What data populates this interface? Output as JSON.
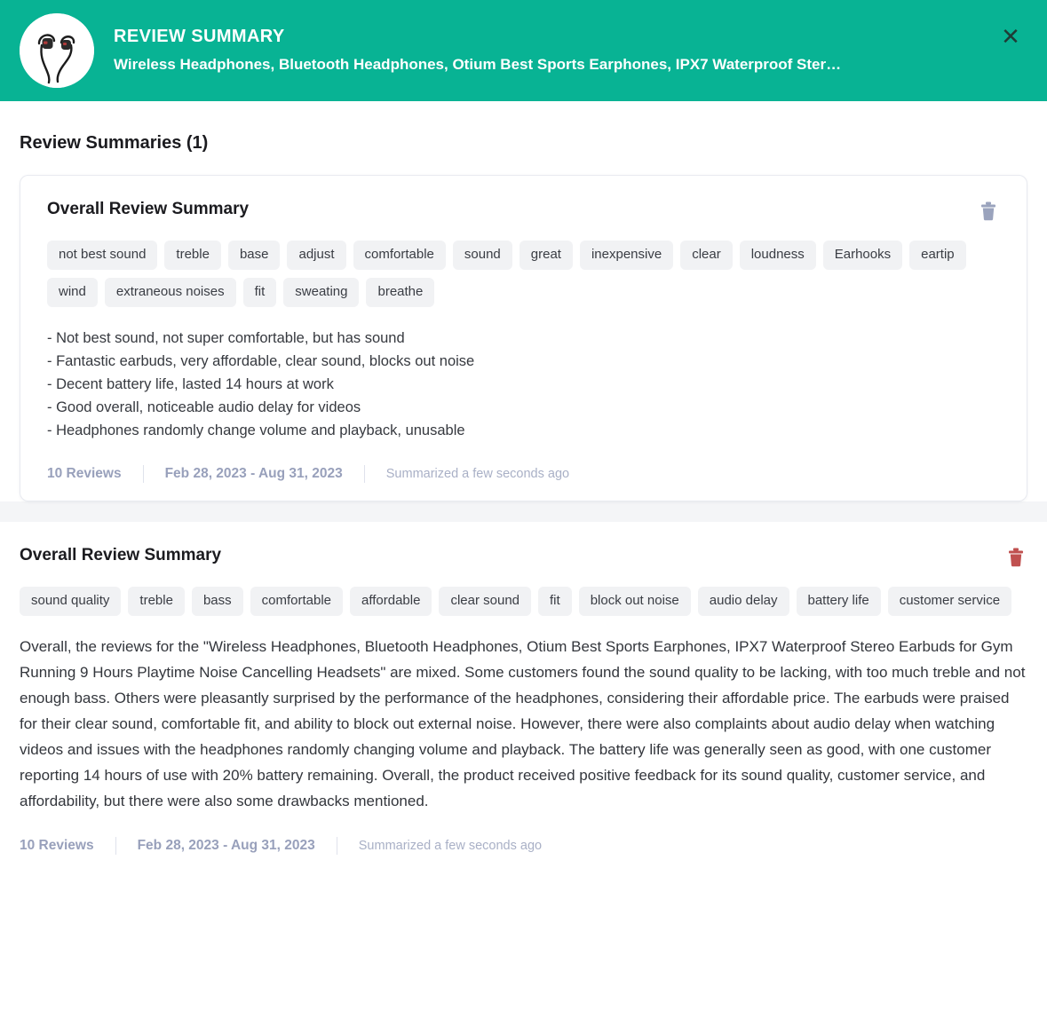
{
  "header": {
    "title": "REVIEW SUMMARY",
    "subtitle": "Wireless Headphones, Bluetooth Headphones, Otium Best Sports Earphones, IPX7 Waterproof Ster…",
    "close_label": "✕",
    "thumbnail_icon": "wireless-earbuds-product-photo",
    "background_color": "#08b394"
  },
  "section": {
    "title": "Review Summaries (1)"
  },
  "cards": [
    {
      "title": "Overall Review Summary",
      "delete_icon": "trash-icon",
      "delete_icon_color": "#9aa3bd",
      "tags": [
        "not best sound",
        "treble",
        "base",
        "adjust",
        "comfortable",
        "sound",
        "great",
        "inexpensive",
        "clear",
        "loudness",
        "Earhooks",
        "eartip",
        "wind",
        "extraneous noises",
        "fit",
        "sweating",
        "breathe"
      ],
      "bullets": [
        "- Not best sound, not super comfortable, but has sound",
        "- Fantastic earbuds, very affordable, clear sound, blocks out noise",
        "- Decent battery life, lasted 14 hours at work",
        "- Good overall, noticeable audio delay for videos",
        "- Headphones randomly change volume and playback, unusable"
      ],
      "paragraph": "",
      "meta": {
        "reviews": "10 Reviews",
        "date_range": "Feb 28, 2023 - Aug 31, 2023",
        "summarized": "Summarized a few seconds ago"
      }
    },
    {
      "title": "Overall Review Summary",
      "delete_icon": "trash-icon",
      "delete_icon_color": "#c0504f",
      "tags": [
        "sound quality",
        "treble",
        "bass",
        "comfortable",
        "affordable",
        "clear sound",
        "fit",
        "block out noise",
        "audio delay",
        "battery life",
        "customer service"
      ],
      "bullets": [],
      "paragraph": "Overall, the reviews for the \"Wireless Headphones, Bluetooth Headphones, Otium Best Sports Earphones, IPX7 Waterproof Stereo Earbuds for Gym Running 9 Hours Playtime Noise Cancelling Headsets\" are mixed. Some customers found the sound quality to be lacking, with too much treble and not enough bass. Others were pleasantly surprised by the performance of the headphones, considering their affordable price. The earbuds were praised for their clear sound, comfortable fit, and ability to block out external noise. However, there were also complaints about audio delay when watching videos and issues with the headphones randomly changing volume and playback. The battery life was generally seen as good, with one customer reporting 14 hours of use with 20% battery remaining. Overall, the product received positive feedback for its sound quality, customer service, and affordability, but there were also some drawbacks mentioned.",
      "meta": {
        "reviews": "10 Reviews",
        "date_range": "Feb 28, 2023 - Aug 31, 2023",
        "summarized": "Summarized a few seconds ago"
      }
    }
  ]
}
